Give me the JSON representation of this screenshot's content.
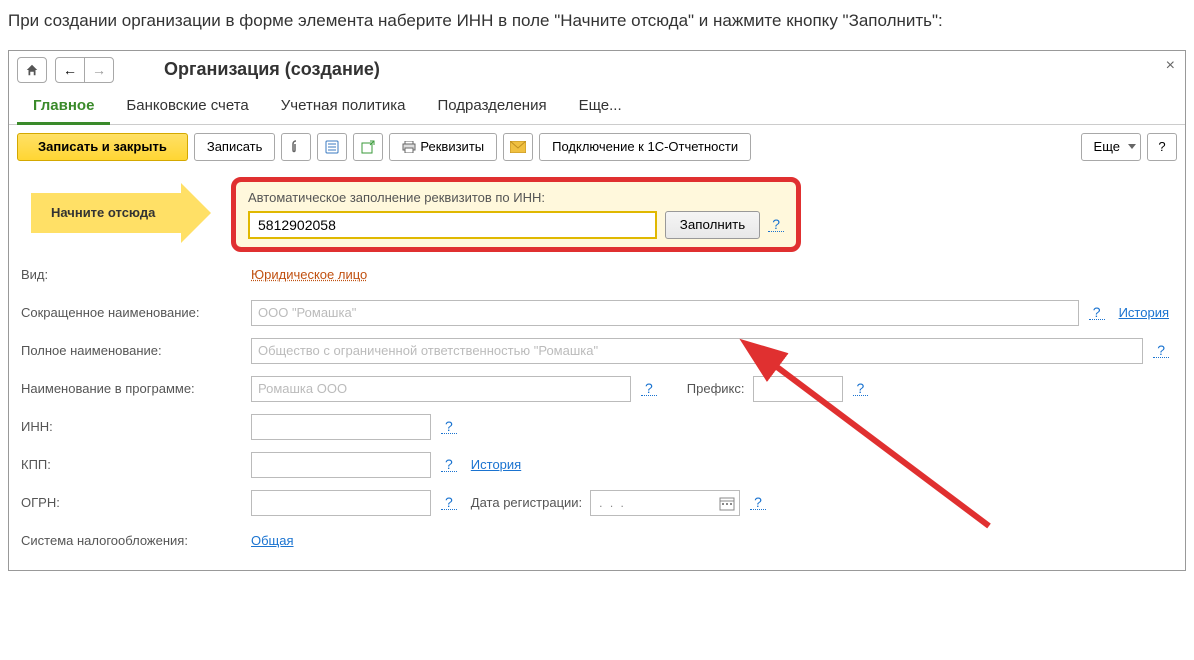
{
  "intro": "При создании организации в форме элемента наберите ИНН в поле \"Начните отсюда\" и нажмите кнопку \"Заполнить\":",
  "window": {
    "title": "Организация (создание)"
  },
  "tabs": {
    "main": "Главное",
    "bank": "Банковские счета",
    "policy": "Учетная политика",
    "divisions": "Подразделения",
    "more": "Еще..."
  },
  "toolbar": {
    "save_close": "Записать и закрыть",
    "save": "Записать",
    "requisites": "Реквизиты",
    "connect_1c": "Подключение к 1С-Отчетности",
    "more": "Еще",
    "help": "?"
  },
  "start_here": {
    "arrow_label": "Начните отсюда",
    "auto_fill_label": "Автоматическое заполнение реквизитов по ИНН:",
    "inn_value": "5812902058",
    "fill_button": "Заполнить",
    "help": "?"
  },
  "fields": {
    "type_label": "Вид:",
    "type_value": "Юридическое лицо",
    "short_name_label": "Сокращенное наименование:",
    "short_name_placeholder": "ООО \"Ромашка\"",
    "full_name_label": "Полное наименование:",
    "full_name_placeholder": "Общество с ограниченной ответственностью \"Ромашка\"",
    "prog_name_label": "Наименование в программе:",
    "prog_name_placeholder": "Ромашка ООО",
    "prefix_label": "Префикс:",
    "inn_label": "ИНН:",
    "kpp_label": "КПП:",
    "ogrn_label": "ОГРН:",
    "reg_date_label": "Дата регистрации:",
    "reg_date_value": ". . .",
    "tax_system_label": "Система налогообложения:",
    "tax_system_value": "Общая",
    "history_link": "История",
    "help": "?"
  }
}
